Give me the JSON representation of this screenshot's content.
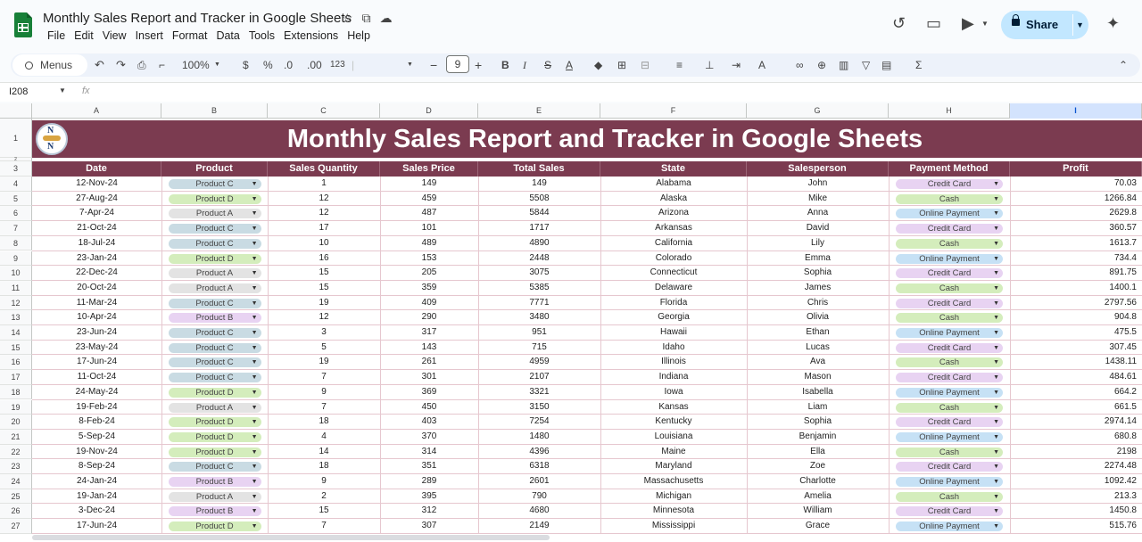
{
  "app": {
    "title": "Monthly Sales Report and Tracker in Google Sheets",
    "menu": [
      "File",
      "Edit",
      "View",
      "Insert",
      "Format",
      "Data",
      "Tools",
      "Extensions",
      "Help"
    ],
    "share_label": "Share"
  },
  "toolbar": {
    "menus_label": "Menus",
    "zoom": "100%",
    "currency": "$",
    "percent": "%",
    "dec_decrease": ".0",
    "dec_increase": ".00",
    "number_format": "123",
    "font_size": "9"
  },
  "formula_bar": {
    "name_box": "I208",
    "fx": "fx"
  },
  "columns": [
    "A",
    "B",
    "C",
    "D",
    "E",
    "F",
    "G",
    "H",
    "I"
  ],
  "selected_column": "I",
  "row_numbers": [
    "1",
    "2",
    "3",
    "4",
    "5",
    "6",
    "7",
    "8",
    "9",
    "10",
    "11",
    "12",
    "13",
    "14",
    "15",
    "16",
    "17",
    "18",
    "19",
    "20",
    "21",
    "22",
    "23",
    "24",
    "25",
    "26",
    "27"
  ],
  "sheet": {
    "banner_title": "Monthly Sales Report and Tracker in Google Sheets",
    "logo_letters": "N N",
    "headers": [
      "Date",
      "Product",
      "Sales Quantity",
      "Sales Price",
      "Total Sales",
      "State",
      "Salesperson",
      "Payment Method",
      "Profit"
    ],
    "rows": [
      [
        "12-Nov-24",
        "Product C",
        "1",
        "149",
        "149",
        "Alabama",
        "John",
        "Credit Card",
        "70.03"
      ],
      [
        "27-Aug-24",
        "Product D",
        "12",
        "459",
        "5508",
        "Alaska",
        "Mike",
        "Cash",
        "1266.84"
      ],
      [
        "7-Apr-24",
        "Product A",
        "12",
        "487",
        "5844",
        "Arizona",
        "Anna",
        "Online Payment",
        "2629.8"
      ],
      [
        "21-Oct-24",
        "Product C",
        "17",
        "101",
        "1717",
        "Arkansas",
        "David",
        "Credit Card",
        "360.57"
      ],
      [
        "18-Jul-24",
        "Product C",
        "10",
        "489",
        "4890",
        "California",
        "Lily",
        "Cash",
        "1613.7"
      ],
      [
        "23-Jan-24",
        "Product D",
        "16",
        "153",
        "2448",
        "Colorado",
        "Emma",
        "Online Payment",
        "734.4"
      ],
      [
        "22-Dec-24",
        "Product A",
        "15",
        "205",
        "3075",
        "Connecticut",
        "Sophia",
        "Credit Card",
        "891.75"
      ],
      [
        "20-Oct-24",
        "Product A",
        "15",
        "359",
        "5385",
        "Delaware",
        "James",
        "Cash",
        "1400.1"
      ],
      [
        "11-Mar-24",
        "Product C",
        "19",
        "409",
        "7771",
        "Florida",
        "Chris",
        "Credit Card",
        "2797.56"
      ],
      [
        "10-Apr-24",
        "Product B",
        "12",
        "290",
        "3480",
        "Georgia",
        "Olivia",
        "Cash",
        "904.8"
      ],
      [
        "23-Jun-24",
        "Product C",
        "3",
        "317",
        "951",
        "Hawaii",
        "Ethan",
        "Online Payment",
        "475.5"
      ],
      [
        "23-May-24",
        "Product C",
        "5",
        "143",
        "715",
        "Idaho",
        "Lucas",
        "Credit Card",
        "307.45"
      ],
      [
        "17-Jun-24",
        "Product C",
        "19",
        "261",
        "4959",
        "Illinois",
        "Ava",
        "Cash",
        "1438.11"
      ],
      [
        "11-Oct-24",
        "Product C",
        "7",
        "301",
        "2107",
        "Indiana",
        "Mason",
        "Credit Card",
        "484.61"
      ],
      [
        "24-May-24",
        "Product D",
        "9",
        "369",
        "3321",
        "Iowa",
        "Isabella",
        "Online Payment",
        "664.2"
      ],
      [
        "19-Feb-24",
        "Product A",
        "7",
        "450",
        "3150",
        "Kansas",
        "Liam",
        "Cash",
        "661.5"
      ],
      [
        "8-Feb-24",
        "Product D",
        "18",
        "403",
        "7254",
        "Kentucky",
        "Sophia",
        "Credit Card",
        "2974.14"
      ],
      [
        "5-Sep-24",
        "Product D",
        "4",
        "370",
        "1480",
        "Louisiana",
        "Benjamin",
        "Online Payment",
        "680.8"
      ],
      [
        "19-Nov-24",
        "Product D",
        "14",
        "314",
        "4396",
        "Maine",
        "Ella",
        "Cash",
        "2198"
      ],
      [
        "8-Sep-24",
        "Product C",
        "18",
        "351",
        "6318",
        "Maryland",
        "Zoe",
        "Credit Card",
        "2274.48"
      ],
      [
        "24-Jan-24",
        "Product B",
        "9",
        "289",
        "2601",
        "Massachusetts",
        "Charlotte",
        "Online Payment",
        "1092.42"
      ],
      [
        "19-Jan-24",
        "Product A",
        "2",
        "395",
        "790",
        "Michigan",
        "Amelia",
        "Cash",
        "213.3"
      ],
      [
        "3-Dec-24",
        "Product B",
        "15",
        "312",
        "4680",
        "Minnesota",
        "William",
        "Credit Card",
        "1450.8"
      ],
      [
        "17-Jun-24",
        "Product D",
        "7",
        "307",
        "2149",
        "Mississippi",
        "Grace",
        "Online Payment",
        "515.76"
      ]
    ]
  },
  "colors": {
    "banner": "#7b3b50",
    "product": {
      "Product A": "#e3e3e3",
      "Product B": "#e8d3f2",
      "Product C": "#c9dbe3",
      "Product D": "#d4edbc"
    },
    "payment": {
      "Credit Card": "#e8d3f2",
      "Cash": "#d4edbc",
      "Online Payment": "#c6e1f5"
    }
  }
}
